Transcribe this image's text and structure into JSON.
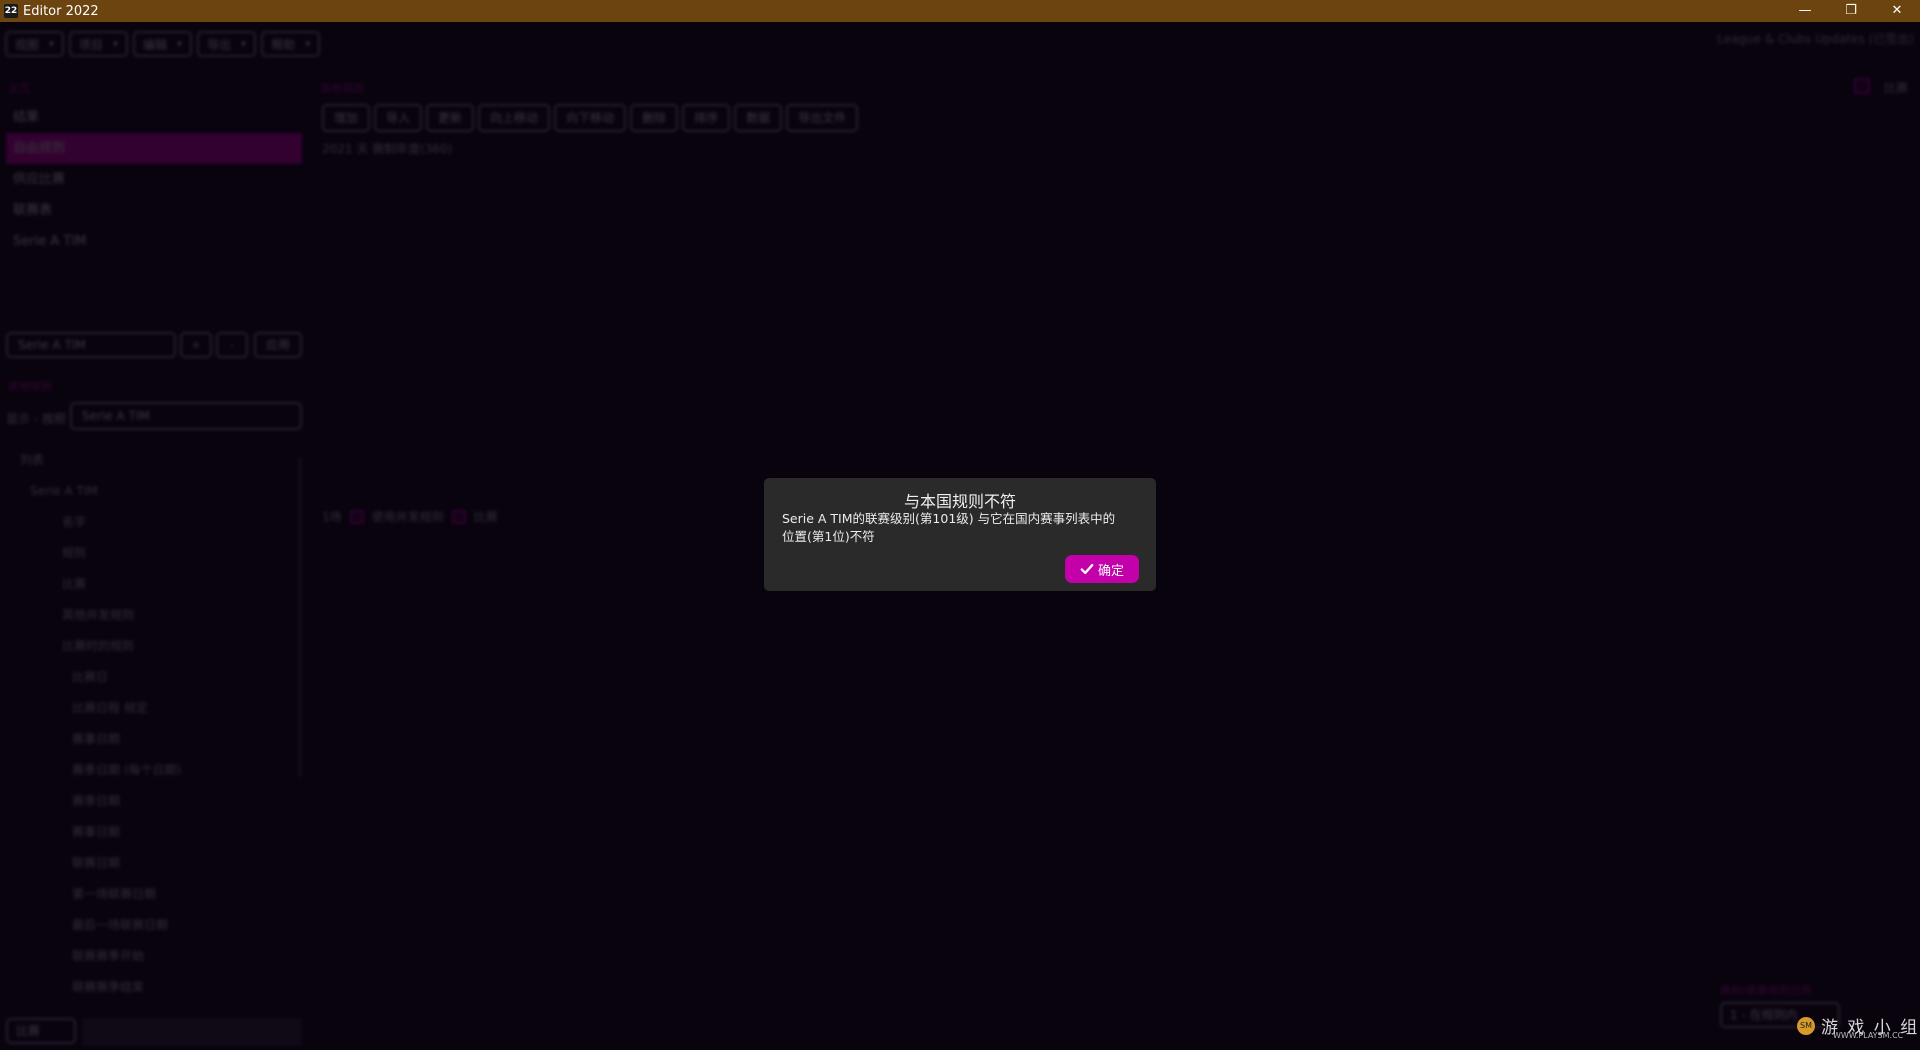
{
  "window": {
    "title": "Editor 2022",
    "icon": "22",
    "minimize_glyph": "—",
    "restore_glyph": "❐",
    "close_glyph": "✕"
  },
  "menubar": {
    "items": [
      "视图",
      "项目",
      "编辑",
      "导出",
      "帮助"
    ]
  },
  "top_right_text": "League & Clubs Updates (已签出)",
  "left_section_label": "主页",
  "sidebar": {
    "items": [
      "结果",
      "自由规则",
      "供应比赛",
      "联赛表",
      "Serie A TIM"
    ]
  },
  "league_select": {
    "value": "Serie A TIM",
    "small_btn_1": "+",
    "small_btn_2": "-",
    "small_btn_3": "应用"
  },
  "rules_section_label": "其他规则",
  "filter": {
    "label": "显示 - 按照",
    "value": "Serie A TIM"
  },
  "tree": {
    "items": [
      "列表",
      "Serie A TIM",
      "名字",
      "规则",
      "比赛",
      "其他并发规则",
      "比赛时的规则",
      "比赛日",
      "比赛日程 规定",
      "赛事日期",
      "赛季日期 (每个日期)",
      "赛季日期",
      "赛事日期",
      "联赛日期",
      "第一场联赛日期",
      "最后一场联赛日期",
      "联赛赛季开始",
      "联赛赛季结束",
      "赛季最后日期"
    ]
  },
  "toolbar": {
    "items": [
      "增加",
      "导入",
      "更新",
      "向上移动",
      "向下移动",
      "删除",
      "排序",
      "数据",
      "导出文件"
    ]
  },
  "hint_text": "2021 天 赛制年度(360)",
  "check_row": {
    "label": "1场",
    "option_1": "使用并发规则",
    "option_2": "比赛"
  },
  "right_check_label": "比赛",
  "bottom_left": {
    "button": "比赛"
  },
  "bottom_right": {
    "label": "赛制/赛事规则应用",
    "select": "1 - 在规则内"
  },
  "dialog": {
    "title": "与本国规则不符",
    "line_1": "Serie A TIM的联赛级别(第101级) 与它在国内赛事列表中的",
    "line_2": "位置(第1位)不符",
    "ok_label": "确定"
  },
  "watermark": {
    "badge": "SM",
    "text": "游 戏 小 组",
    "sub": "WWW.PLAYSM.CC"
  },
  "colors": {
    "accent": "#c400aa",
    "titlebar": "#6b4410",
    "background": "#0b0512",
    "dialog_bg": "#2a2a2a"
  }
}
